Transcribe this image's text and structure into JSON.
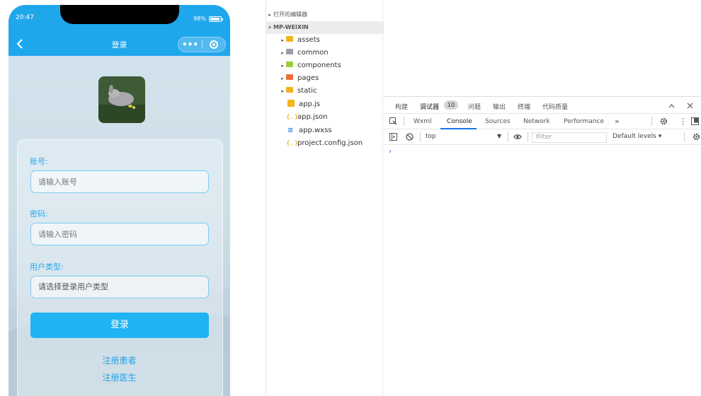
{
  "simulator": {
    "status_time": "20:47",
    "battery": "98%",
    "nav_title": "登录",
    "capsule_more": "•••",
    "form": {
      "account_label": "账号:",
      "account_placeholder": "请输入账号",
      "password_label": "密码:",
      "password_placeholder": "请输入密码",
      "usertype_label": "用户类型:",
      "usertype_value": "请选择登录用户类型",
      "login_button": "登录",
      "register_patient": "注册患者",
      "register_doctor": "注册医生"
    },
    "colors": {
      "primary": "#1fa7ec",
      "button": "#1fb3f4",
      "label": "#29a9e8"
    }
  },
  "explorer": {
    "open_editors": "打开的编辑器",
    "project_root": "MP-WEIXIN",
    "items": [
      {
        "name": "assets",
        "type": "folder",
        "icon": "folder-icon",
        "color": "#f2b31b"
      },
      {
        "name": "common",
        "type": "folder",
        "icon": "folder-icon",
        "color": "#9aa0a6"
      },
      {
        "name": "components",
        "type": "folder",
        "icon": "folder-icon",
        "color": "#9ccc3c"
      },
      {
        "name": "pages",
        "type": "folder",
        "icon": "folder-icon",
        "color": "#f26b3a"
      },
      {
        "name": "static",
        "type": "folder",
        "icon": "folder-icon",
        "color": "#f2b31b"
      },
      {
        "name": "app.js",
        "type": "file",
        "icon": "js-file-icon"
      },
      {
        "name": "app.json",
        "type": "file",
        "icon": "json-file-icon"
      },
      {
        "name": "app.wxss",
        "type": "file",
        "icon": "wxss-file-icon"
      },
      {
        "name": "project.config.json",
        "type": "file",
        "icon": "json-file-icon"
      }
    ]
  },
  "devtools": {
    "top_tabs": [
      "构建",
      "调试器",
      "问题",
      "输出",
      "终端",
      "代码质量"
    ],
    "debugger_badge": "10",
    "panel_tabs": [
      "Wxml",
      "Console",
      "Sources",
      "Network",
      "Performance"
    ],
    "more_tabs": "»",
    "active_panel": "Console",
    "context": "top",
    "filter_placeholder": "Filter",
    "levels": "Default levels ▾",
    "prompt": "›"
  }
}
